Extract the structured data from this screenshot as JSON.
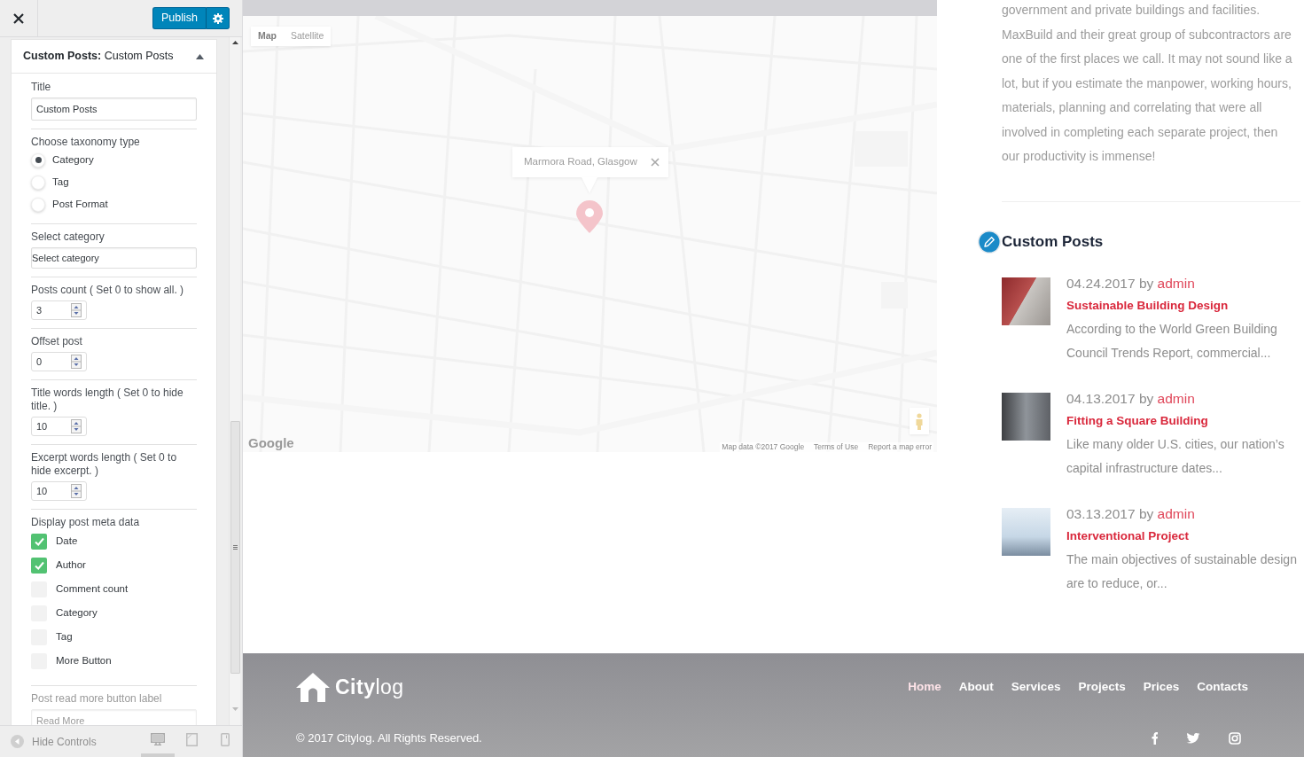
{
  "customizer": {
    "publish_label": "Publish",
    "section": {
      "title": "**Custom Posts:** Custom Posts",
      "expanded": true
    },
    "fields": [
      {
        "kind": "text",
        "label": "Title",
        "value": "Custom Posts"
      },
      {
        "kind": "radio",
        "label": "Choose taxonomy type",
        "options": [
          {
            "label": "Category",
            "selected": true
          },
          {
            "label": "Tag",
            "selected": false
          },
          {
            "label": "Post Format",
            "selected": false
          }
        ]
      },
      {
        "kind": "select",
        "label": "Select category",
        "value": "Select category"
      },
      {
        "kind": "number",
        "label": "Posts count ( Set 0 to show all. )",
        "value": "3"
      },
      {
        "kind": "number",
        "label": "Offset post",
        "value": "0"
      },
      {
        "kind": "number",
        "label": "Title words length ( Set 0 to hide title. )",
        "value": "10"
      },
      {
        "kind": "number",
        "label": "Excerpt words length ( Set 0 to hide excerpt. )",
        "value": "10"
      },
      {
        "kind": "checkbox",
        "label": "Display post meta data",
        "options": [
          {
            "label": "Date",
            "checked": true
          },
          {
            "label": "Author",
            "checked": true
          },
          {
            "label": "Comment count",
            "checked": false
          },
          {
            "label": "Category",
            "checked": false
          },
          {
            "label": "Tag",
            "checked": false
          },
          {
            "label": "More Button",
            "checked": false
          }
        ]
      },
      {
        "kind": "text",
        "label": "Post read more button label",
        "value": "Read More"
      }
    ],
    "footer": {
      "hide_label": "Hide Controls",
      "devices": [
        {
          "kind": "desktop",
          "selected": true
        },
        {
          "kind": "tablet",
          "selected": false
        },
        {
          "kind": "mobile",
          "selected": false
        }
      ]
    }
  },
  "preview": {
    "map": {
      "types": [
        {
          "label": "Map",
          "selected": true
        },
        {
          "label": "Satellite",
          "selected": false
        }
      ],
      "info_window": "Marmora Road, Glasgow",
      "logo": "Google",
      "attribution": [
        "Map data ©2017 Google",
        "Terms of Use",
        "Report a map error"
      ]
    },
    "intro": "government and private buildings and facilities. MaxBuild and their great group of subcontractors are one of the first places we call. It may not sound like a lot, but if you estimate the manpower, working hours, materials, planning and correlating that were all involved in completing each separate project, then our productivity is immense!",
    "widget": {
      "title": "Custom Posts",
      "posts": [
        {
          "date": "04.24.2017",
          "by": "by",
          "author": "admin",
          "title": "Sustainable Building Design",
          "excerpt": "According to the World Green Building Council Trends Report, commercial..."
        },
        {
          "date": "04.13.2017",
          "by": "by",
          "author": "admin",
          "title": "Fitting a Square Building",
          "excerpt": "Like many older U.S. cities, our nation’s capital infrastructure dates..."
        },
        {
          "date": "03.13.2017",
          "by": "by",
          "author": "admin",
          "title": "Interventional Project",
          "excerpt": "The main objectives of sustainable design are to reduce, or..."
        }
      ]
    },
    "footer": {
      "logo": "**City**log",
      "nav": [
        {
          "label": "Home",
          "selected": true
        },
        {
          "label": "About",
          "selected": false
        },
        {
          "label": "Services",
          "selected": false
        },
        {
          "label": "Projects",
          "selected": false
        },
        {
          "label": "Prices",
          "selected": false
        },
        {
          "label": "Contacts",
          "selected": false
        }
      ],
      "copyright": "© 2017 Citylog. All Rights Reserved.",
      "social": [
        {
          "kind": "facebook"
        },
        {
          "kind": "twitter"
        },
        {
          "kind": "instagram"
        }
      ]
    }
  }
}
